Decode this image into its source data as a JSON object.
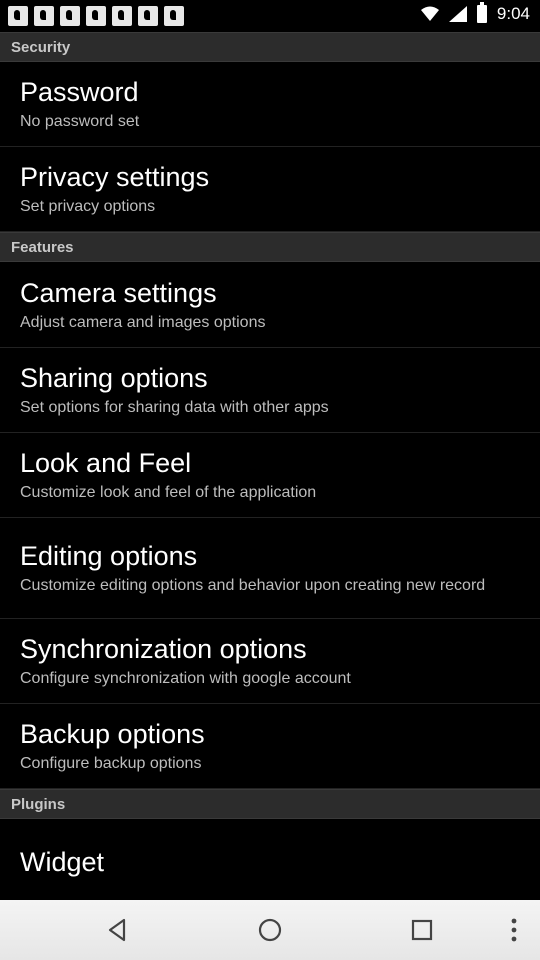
{
  "status_bar": {
    "time": "9:04",
    "notification_icons": [
      "music-icon",
      "music-icon",
      "music-icon",
      "music-icon",
      "music-icon",
      "dropbox-icon",
      "music-icon"
    ]
  },
  "sections": {
    "security": {
      "header": "Security",
      "items": [
        {
          "title": "Password",
          "summary": "No password set"
        },
        {
          "title": "Privacy settings",
          "summary": "Set privacy options"
        }
      ]
    },
    "features": {
      "header": "Features",
      "items": [
        {
          "title": "Camera settings",
          "summary": "Adjust camera and images options"
        },
        {
          "title": "Sharing options",
          "summary": "Set options for sharing data with other apps"
        },
        {
          "title": "Look and Feel",
          "summary": "Customize look and feel of the application"
        },
        {
          "title": "Editing options",
          "summary": "Customize editing options and behavior upon creating new record"
        },
        {
          "title": "Synchronization options",
          "summary": "Configure synchronization with google account"
        },
        {
          "title": "Backup options",
          "summary": "Configure backup options"
        }
      ]
    },
    "plugins": {
      "header": "Plugins",
      "items": [
        {
          "title": "Widget"
        }
      ]
    }
  },
  "colors": {
    "background": "#000000",
    "section_header_bg": "#2c2c2c",
    "title_text": "#ffffff",
    "summary_text": "#bdbdbd",
    "navbar_bg": "#eeeeee"
  }
}
